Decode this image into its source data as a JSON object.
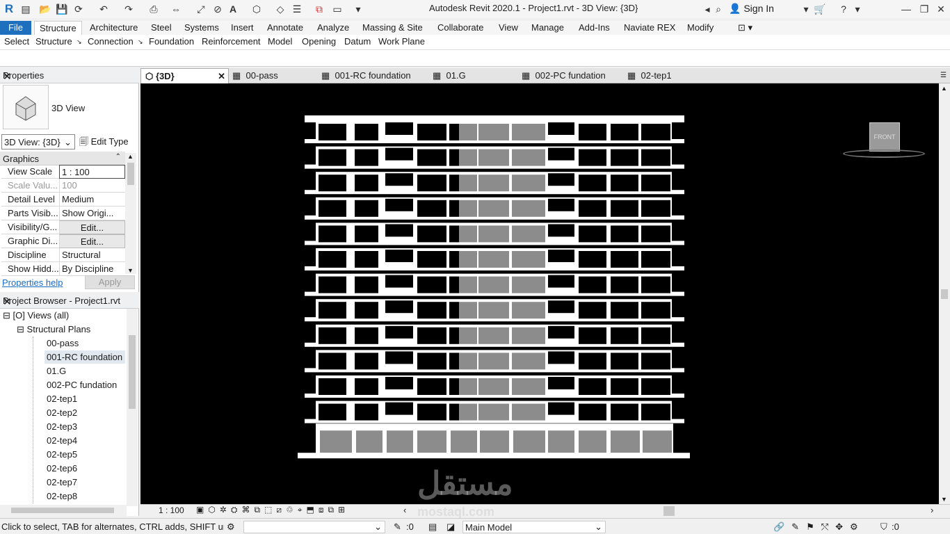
{
  "app": {
    "title": "Autodesk Revit 2020.1 - Project1.rvt - 3D View: {3D}",
    "sign_in": "Sign In"
  },
  "ribbon": {
    "tabs": [
      "File",
      "Structure",
      "Architecture",
      "Steel",
      "Systems",
      "Insert",
      "Annotate",
      "Analyze",
      "Massing & Site",
      "Collaborate",
      "View",
      "Manage",
      "Add-Ins",
      "Naviate REX",
      "Modify"
    ],
    "active_tab": "Structure",
    "panels": [
      "Select",
      "Structure",
      "Connection",
      "Foundation",
      "Reinforcement",
      "Model",
      "Opening",
      "Datum",
      "Work Plane"
    ]
  },
  "properties": {
    "title": "Properties",
    "type_name": "3D View",
    "selector": "3D View: {3D}",
    "edit_type": "Edit Type",
    "group": "Graphics",
    "rows": [
      {
        "k": "View Scale",
        "v": "1 : 100"
      },
      {
        "k": "Scale Valu...",
        "v": "100"
      },
      {
        "k": "Detail Level",
        "v": "Medium"
      },
      {
        "k": "Parts Visib...",
        "v": "Show Origi..."
      },
      {
        "k": "Visibility/G...",
        "v": "Edit..."
      },
      {
        "k": "Graphic Di...",
        "v": "Edit..."
      },
      {
        "k": "Discipline",
        "v": "Structural"
      },
      {
        "k": "Show Hidd...",
        "v": "By Discipline"
      }
    ],
    "help": "Properties help",
    "apply": "Apply"
  },
  "browser": {
    "title": "Project Browser - Project1.rvt",
    "views": "Views (all)",
    "group": "Structural Plans",
    "items": [
      "00-pass",
      "001-RC foundation",
      "01.G",
      "002-PC fundation",
      "02-tep1",
      "02-tep2",
      "02-tep3",
      "02-tep4",
      "02-tep5",
      "02-tep6",
      "02-tep7",
      "02-tep8"
    ],
    "selected": "001-RC foundation"
  },
  "doc_tabs": [
    "{3D}",
    "00-pass",
    "001-RC foundation",
    "01.G",
    "002-PC fundation",
    "02-tep1"
  ],
  "viewcube_label": "FRONT",
  "view_bar": {
    "scale": "1 : 100"
  },
  "status": {
    "hint": "Click to select, TAB for alternates, CTRL adds, SHIFT uns",
    "count_a": ":0",
    "workset": "Main Model",
    "filter_count": ":0"
  },
  "watermark": {
    "main": "مستقل",
    "sub": "mostaql.com"
  },
  "colors": {
    "accent": "#1f6fbf",
    "view_bg": "#000000",
    "building": "#ffffff",
    "panel_gray": "#8c8c8c"
  }
}
